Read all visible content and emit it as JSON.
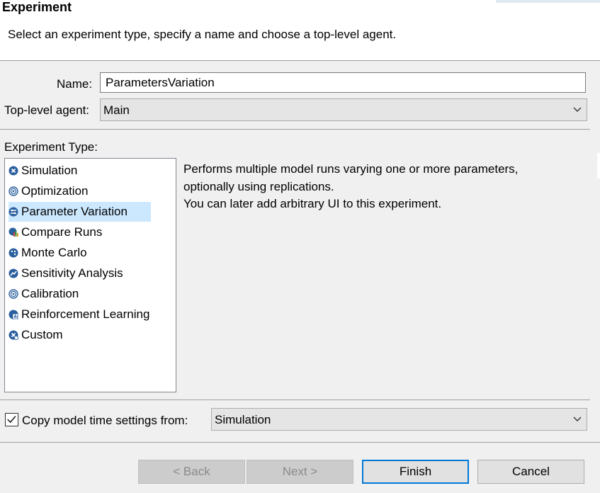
{
  "header": {
    "title": "Experiment",
    "description": "Select an experiment type, specify a name and choose a top-level agent."
  },
  "form": {
    "name_label": "Name:",
    "name_value": "ParametersVariation",
    "agent_label": "Top-level agent:",
    "agent_value": "Main"
  },
  "experiment_type": {
    "label": "Experiment Type:",
    "selected": "Parameter Variation",
    "items": [
      {
        "label": "Simulation",
        "icon": "simulation-icon"
      },
      {
        "label": "Optimization",
        "icon": "optimization-icon"
      },
      {
        "label": "Parameter Variation",
        "icon": "parameter-variation-icon"
      },
      {
        "label": "Compare Runs",
        "icon": "compare-runs-icon"
      },
      {
        "label": "Monte Carlo",
        "icon": "monte-carlo-icon"
      },
      {
        "label": "Sensitivity Analysis",
        "icon": "sensitivity-analysis-icon"
      },
      {
        "label": "Calibration",
        "icon": "calibration-icon"
      },
      {
        "label": "Reinforcement Learning",
        "icon": "reinforcement-learning-icon"
      },
      {
        "label": "Custom",
        "icon": "custom-icon"
      }
    ],
    "description": [
      "Performs multiple model runs varying one or more parameters,",
      "optionally using replications.",
      "You can later add arbitrary UI to this experiment."
    ]
  },
  "time_settings": {
    "checked": true,
    "label": "Copy model time settings from:",
    "value": "Simulation"
  },
  "buttons": {
    "back": "< Back",
    "next": "Next >",
    "finish": "Finish",
    "cancel": "Cancel"
  },
  "colors": {
    "selection": "#cce8ff",
    "default_button_border": "#0078d7",
    "icon_blue": "#2a5f9e"
  }
}
